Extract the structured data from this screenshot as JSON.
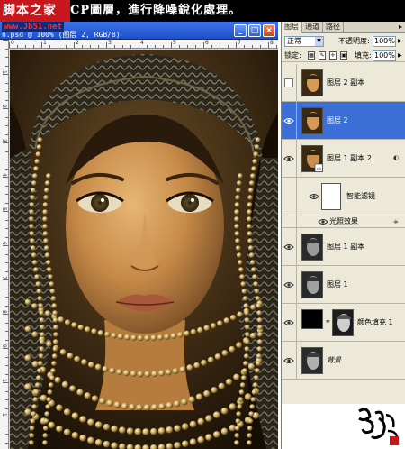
{
  "caption": {
    "site_badge": "脚本之家",
    "text": "CP圖層，進行降噪銳化處理。"
  },
  "document": {
    "site_url": "www.Jb51.net",
    "title": "n.psd @ 100% (图层 2, RGB/8)",
    "buttons": {
      "minimize": "_",
      "maximize": "□",
      "close": "×"
    },
    "ruler_top_numbers": [
      "0",
      "1",
      "2",
      "3",
      "4",
      "5",
      "6",
      "7",
      "8"
    ],
    "ruler_left_numbers": [
      "1",
      "2",
      "3",
      "4",
      "5",
      "6",
      "7",
      "8",
      "9",
      "1",
      "1"
    ]
  },
  "panel": {
    "tabs": [
      "图层",
      "通道",
      "路径"
    ],
    "menu_icon": "▸",
    "blend_mode": "正常",
    "opacity_label": "不透明度:",
    "opacity_value": "100%",
    "lock_label": "锁定:",
    "fill_label": "填充:",
    "fill_value": "100%",
    "layers": [
      {
        "name": "图层 2 副本",
        "visible": false,
        "selected": false
      },
      {
        "name": "图层 2",
        "visible": true,
        "selected": true
      },
      {
        "name": "图层 1 副本 2",
        "visible": true,
        "selected": false
      },
      {
        "name": "图层 1 副本",
        "visible": true,
        "selected": false
      },
      {
        "name": "图层 1",
        "visible": true,
        "selected": false
      },
      {
        "name": "颜色填充 1",
        "visible": true,
        "selected": false
      },
      {
        "name": "背景",
        "visible": true,
        "selected": false
      }
    ],
    "smart_filter_label": "智能滤镜",
    "effect_label": "光照效果"
  },
  "colors": {
    "title_bar": "#2a5fd8",
    "selected_layer": "#3b6fd6",
    "panel_bg": "#ece9d8",
    "badge": "#c8171c"
  }
}
